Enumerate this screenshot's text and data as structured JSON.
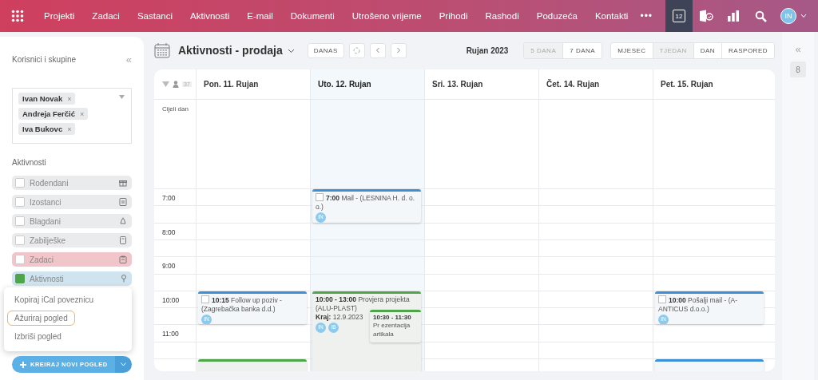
{
  "topbar": {
    "nav": [
      {
        "label": "Projekti"
      },
      {
        "label": "Zadaci"
      },
      {
        "label": "Sastanci"
      },
      {
        "label": "Aktivnosti"
      },
      {
        "label": "E-mail"
      },
      {
        "label": "Dokumenti"
      },
      {
        "label": "Utrošeno vrijeme"
      },
      {
        "label": "Prihodi"
      },
      {
        "label": "Rashodi"
      },
      {
        "label": "Poduzeća"
      },
      {
        "label": "Kontakti"
      }
    ],
    "more": "•••",
    "calendar_day": "12",
    "avatar": "IN"
  },
  "sidebar": {
    "title": "Korisnici i skupine",
    "collapse": "«",
    "users": [
      "Ivan Novak",
      "Andreja Ferčić",
      "Iva Bukovc"
    ],
    "remove": "×",
    "section": "Aktivnosti",
    "filters": [
      {
        "label": "Rođendani",
        "checked": false,
        "color": "#eaebed",
        "kind": "gift"
      },
      {
        "label": "Izostanci",
        "checked": false,
        "color": "#eaebed",
        "kind": "doc"
      },
      {
        "label": "Blagdani",
        "checked": false,
        "color": "#eaebed",
        "kind": "bell"
      },
      {
        "label": "Zabilješke",
        "checked": false,
        "color": "#eaebed",
        "kind": "note"
      },
      {
        "label": "Zadaci",
        "checked": false,
        "color": "#f1c6ca",
        "kind": "clipboard"
      },
      {
        "label": "Aktivnosti",
        "checked": true,
        "color": "#cfe4ef",
        "kind": "pin"
      }
    ],
    "menu": [
      {
        "label": "Kopiraj iCal poveznicu",
        "selected": false
      },
      {
        "label": "Ažuriraj pogled",
        "selected": true
      },
      {
        "label": "Izbriši pogled",
        "selected": false
      }
    ],
    "create_button": "KREIRAJ NOVI POGLED"
  },
  "toolbar": {
    "title": "Aktivnosti - prodaja",
    "today": "DANAS",
    "month_label": "Rujan 2023",
    "range": [
      {
        "label": "5 DANA",
        "selected": true
      },
      {
        "label": "7 DANA",
        "selected": false
      }
    ],
    "views": [
      {
        "label": "MJESEC",
        "selected": false
      },
      {
        "label": "TJEDAN",
        "selected": true
      },
      {
        "label": "DAN",
        "selected": false
      },
      {
        "label": "RASPORED",
        "selected": false
      }
    ]
  },
  "calendar": {
    "user_count": "37",
    "all_day": "Cijeli dan",
    "days": [
      {
        "label": "Pon. 11. Rujan",
        "today": false
      },
      {
        "label": "Uto. 12. Rujan",
        "today": true
      },
      {
        "label": "Sri. 13. Rujan",
        "today": false
      },
      {
        "label": "Čet. 14. Rujan",
        "today": false
      },
      {
        "label": "Pet. 15. Rujan",
        "today": false
      }
    ],
    "hours": [
      "7:00",
      "8:00",
      "9:00",
      "10:00",
      "11:00"
    ],
    "events": [
      {
        "kind": "task",
        "color": "#3d8fd6",
        "text": "**7:00** Mail - (LESNINA H. d. o. o.)",
        "avatars": [
          "IN"
        ]
      },
      {
        "kind": "task",
        "color": "#3d8fd6",
        "text": "**10:15** Follow up poziv - (Zagrebačka banka d.d.)",
        "avatars": [
          "IN"
        ]
      },
      {
        "kind": "meeting",
        "color": "#4fa64a",
        "text": "**10:00 - 13:00** Provjera projekta (ALU-PLAST)",
        "detail": "**Kraj:** 12.9.2023",
        "avatars": [
          "IN",
          "IB"
        ]
      },
      {
        "kind": "meeting",
        "color": "#4fa64a",
        "text": "**10:30 - 11:30** Pr ezentacija artikala"
      },
      {
        "kind": "task",
        "color": "#3d8fd6",
        "text": "**10:00** Pošalji mail - (A-ANTICUS d.o.o.)",
        "avatars": [
          "IN"
        ]
      },
      {
        "kind": "meeting",
        "color": "#4fa64a"
      },
      {
        "kind": "task",
        "color": "#3d8fd6"
      }
    ]
  },
  "right_rail": {
    "collapse": "«",
    "count": "8"
  }
}
